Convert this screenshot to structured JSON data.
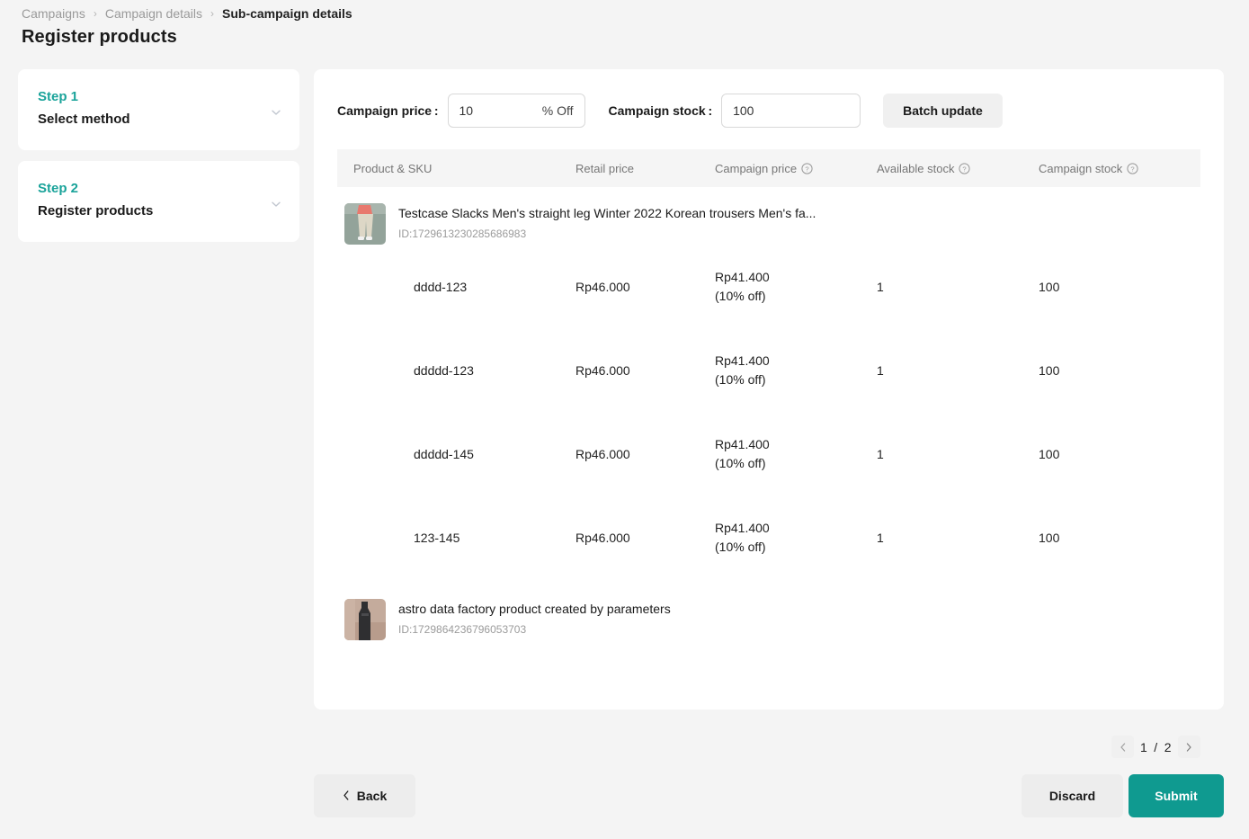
{
  "breadcrumb": {
    "items": [
      "Campaigns",
      "Campaign details",
      "Sub-campaign details"
    ],
    "separator": "›"
  },
  "page_title": "Register products",
  "colors": {
    "accent_teal": "#0f9a90",
    "step_teal": "#1aa39a",
    "page_bg": "#f4f4f4",
    "card_bg": "#ffffff",
    "header_row_bg": "#f5f5f5",
    "muted_text": "#9b9b9b"
  },
  "steps": [
    {
      "kicker": "Step 1",
      "name": "Select method",
      "chevron": "chevron-down-icon"
    },
    {
      "kicker": "Step 2",
      "name": "Register products",
      "chevron": "chevron-down-icon"
    }
  ],
  "toolbar": {
    "price_label": "Campaign price :",
    "price_value": "10",
    "price_placeholder": "",
    "price_suffix": "% Off",
    "stock_label": "Campaign stock :",
    "stock_value": "100",
    "stock_placeholder": "",
    "batch_update_label": "Batch update"
  },
  "table": {
    "columns": [
      {
        "label": "Product & SKU",
        "info": false
      },
      {
        "label": "Retail price",
        "info": false
      },
      {
        "label": "Campaign price",
        "info": true,
        "info_icon": "help-circle-icon"
      },
      {
        "label": "Available stock",
        "info": true,
        "info_icon": "help-circle-icon"
      },
      {
        "label": "Campaign stock",
        "info": true,
        "info_icon": "help-circle-icon"
      }
    ],
    "groups": [
      {
        "product_name": "Testcase Slacks Men's straight leg Winter 2022 Korean trousers Men's fa...",
        "product_id": "ID:1729613230285686983",
        "thumb": "product-photo-trousers",
        "skus": [
          {
            "sku": "dddd-123",
            "retail_price": "Rp46.000",
            "campaign_price": "Rp41.400",
            "campaign_discount": "(10% off)",
            "available_stock": "1",
            "campaign_stock": "100"
          },
          {
            "sku": "ddddd-123",
            "retail_price": "Rp46.000",
            "campaign_price": "Rp41.400",
            "campaign_discount": "(10% off)",
            "available_stock": "1",
            "campaign_stock": "100"
          },
          {
            "sku": "ddddd-145",
            "retail_price": "Rp46.000",
            "campaign_price": "Rp41.400",
            "campaign_discount": "(10% off)",
            "available_stock": "1",
            "campaign_stock": "100"
          },
          {
            "sku": "123-145",
            "retail_price": "Rp46.000",
            "campaign_price": "Rp41.400",
            "campaign_discount": "(10% off)",
            "available_stock": "1",
            "campaign_stock": "100"
          }
        ]
      },
      {
        "product_name": "astro data factory product created by parameters",
        "product_id": "ID:1729864236796053703",
        "thumb": "product-photo-bottle",
        "skus": []
      }
    ]
  },
  "pagination": {
    "prev_icon": "chevron-left-icon",
    "next_icon": "chevron-right-icon",
    "current_page": "1",
    "divider": "/",
    "total_pages": "2"
  },
  "actions": {
    "back_icon": "chevron-left-icon",
    "back_label": "Back",
    "discard_label": "Discard",
    "submit_label": "Submit"
  }
}
